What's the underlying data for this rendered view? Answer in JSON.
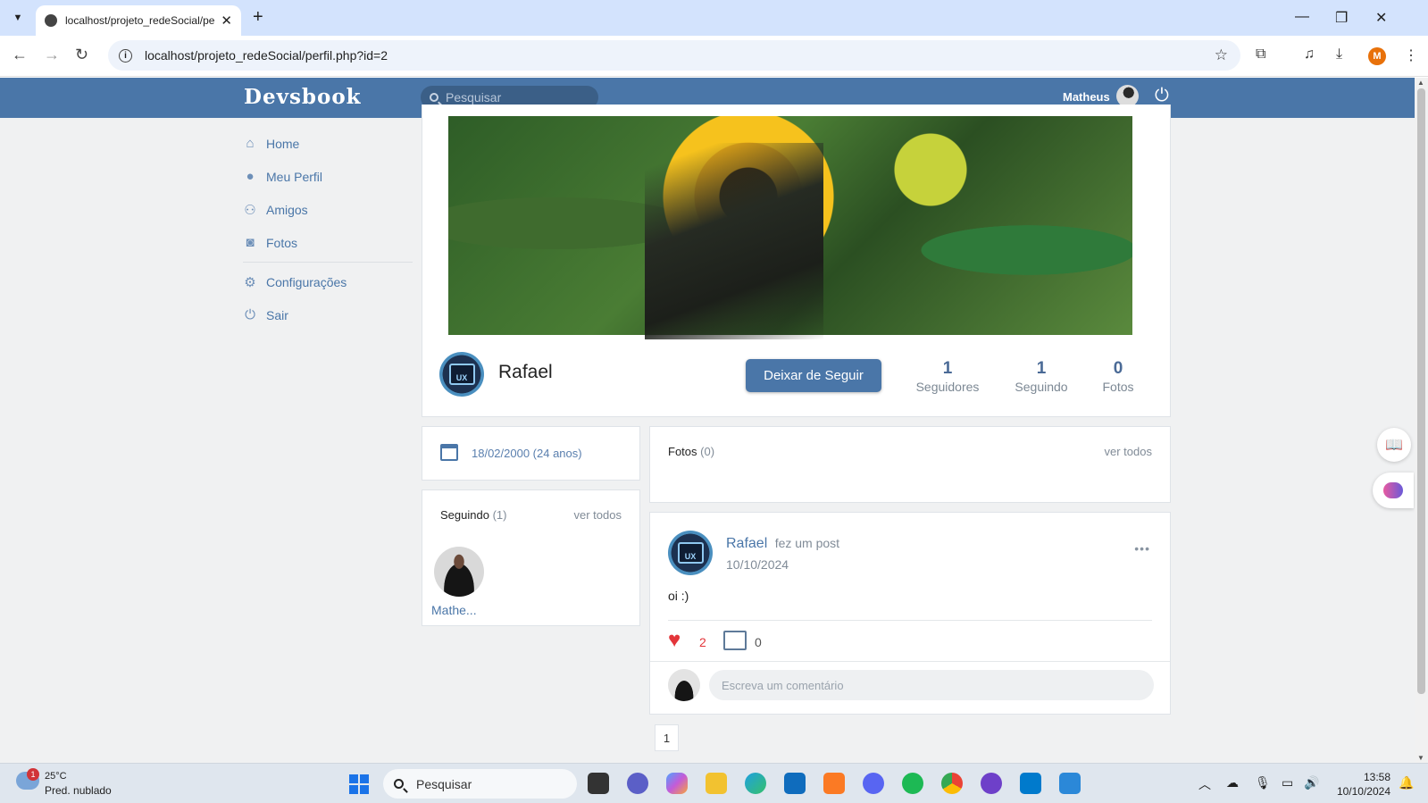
{
  "browser": {
    "tab_title": "localhost/projeto_redeSocial/pe",
    "url": "localhost/projeto_redeSocial/perfil.php?id=2",
    "profile_initial": "M"
  },
  "header": {
    "logo": "Devsbook",
    "search_placeholder": "Pesquisar",
    "user_name": "Matheus"
  },
  "sidebar": {
    "items": [
      {
        "label": "Home",
        "icon": "home-icon"
      },
      {
        "label": "Meu Perfil",
        "icon": "user-icon"
      },
      {
        "label": "Amigos",
        "icon": "friends-icon"
      },
      {
        "label": "Fotos",
        "icon": "camera-icon"
      },
      {
        "label": "Configurações",
        "icon": "gear-icon"
      },
      {
        "label": "Sair",
        "icon": "power-icon"
      }
    ]
  },
  "profile": {
    "name": "Rafael",
    "follow_button": "Deixar de Seguir",
    "stats": [
      {
        "value": "1",
        "label": "Seguidores"
      },
      {
        "value": "1",
        "label": "Seguindo"
      },
      {
        "value": "0",
        "label": "Fotos"
      }
    ],
    "avatar_text": "UX"
  },
  "birthdate": "18/02/2000 (24 anos)",
  "following": {
    "title": "Seguindo",
    "count": "(1)",
    "see_all": "ver todos",
    "users": [
      {
        "name": "Mathe..."
      }
    ]
  },
  "photos": {
    "title": "Fotos",
    "count": "(0)",
    "see_all": "ver todos"
  },
  "post": {
    "author": "Rafael",
    "action": "fez um post",
    "date": "10/10/2024",
    "body": "oi :)",
    "likes": "2",
    "comments": "0",
    "comment_placeholder": "Escreva um comentário",
    "more": "•••"
  },
  "pagination": {
    "current": "1"
  },
  "taskbar": {
    "weather_temp": "25°C",
    "weather_desc": "Pred. nublado",
    "weather_badge": "1",
    "search_label": "Pesquisar",
    "time": "13:58",
    "date": "10/10/2024"
  },
  "colors": {
    "brand": "#4a76a8",
    "like": "#e3353a"
  }
}
